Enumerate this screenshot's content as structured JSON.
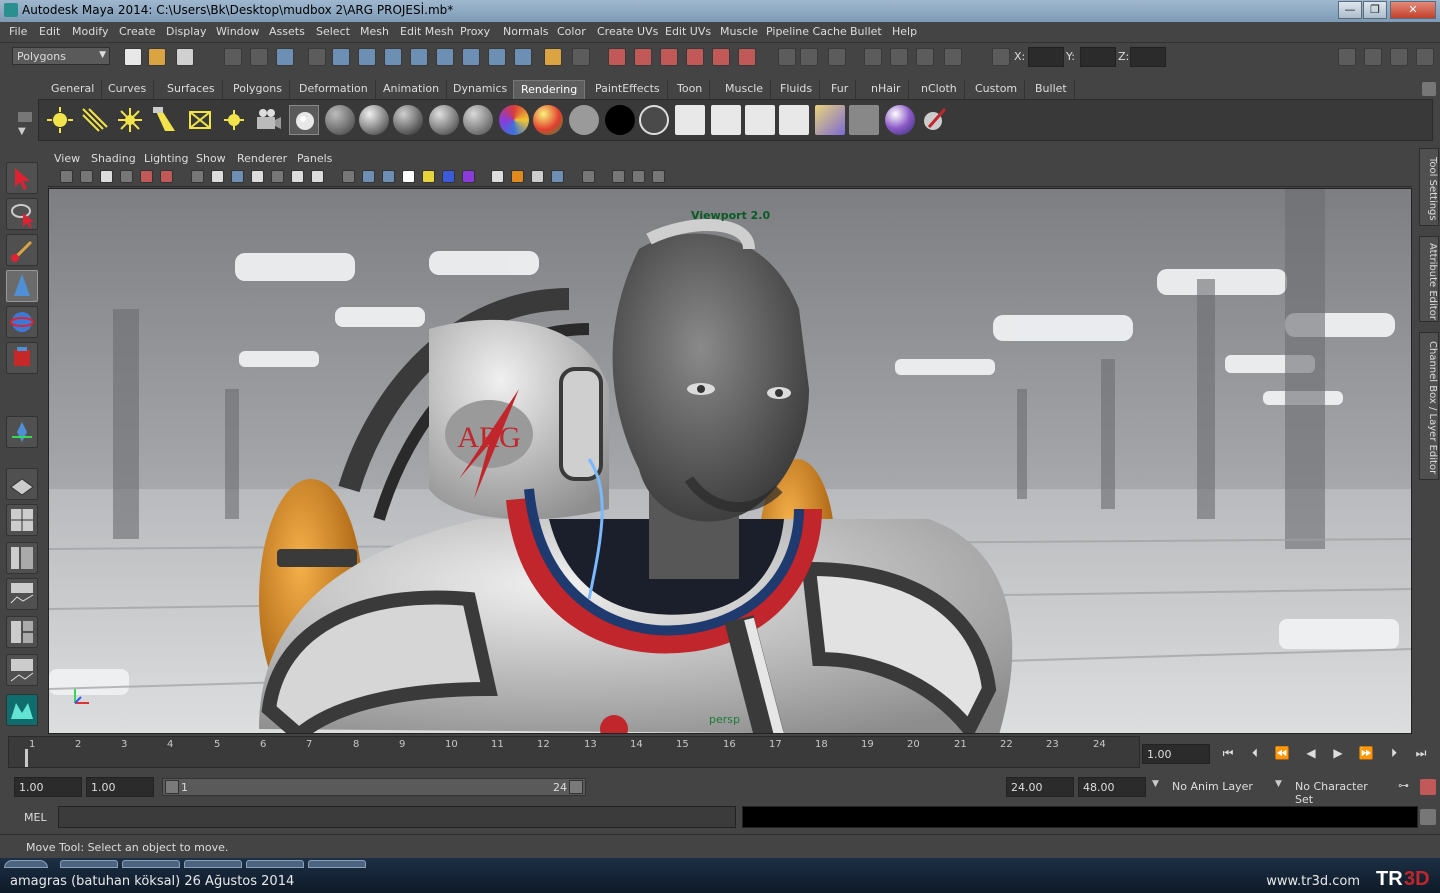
{
  "window": {
    "title": "Autodesk Maya 2014: C:\\Users\\Bk\\Desktop\\mudbox 2\\ARG PROJESİ.mb*",
    "controls": [
      "—",
      "❐",
      "✕"
    ]
  },
  "menubar": [
    "File",
    "Edit",
    "Modify",
    "Create",
    "Display",
    "Window",
    "Assets",
    "Select",
    "Mesh",
    "Edit Mesh",
    "Proxy",
    "Normals",
    "Color",
    "Create UVs",
    "Edit UVs",
    "Muscle",
    "Pipeline Cache",
    "Bullet",
    "Help"
  ],
  "statusline": {
    "mode": "Polygons",
    "x_label": "X:",
    "y_label": "Y:",
    "z_label": "Z:"
  },
  "shelf": {
    "tabs": [
      "General",
      "Curves",
      "Surfaces",
      "Polygons",
      "Deformation",
      "Animation",
      "Dynamics",
      "Rendering",
      "PaintEffects",
      "Toon",
      "Muscle",
      "Fluids",
      "Fur",
      "nHair",
      "nCloth",
      "Custom",
      "Bullet"
    ],
    "active_tab": "Rendering"
  },
  "panel": {
    "menus": [
      "View",
      "Shading",
      "Lighting",
      "Show",
      "Renderer",
      "Panels"
    ],
    "renderer_label": "Viewport 2.0",
    "camera_label": "persp",
    "scene_logo_text": "ARG"
  },
  "side_tabs": [
    "Tool Settings",
    "Attribute Editor",
    "Channel Box / Layer Editor"
  ],
  "timeline": {
    "ticks": [
      "1",
      "2",
      "3",
      "4",
      "5",
      "6",
      "7",
      "8",
      "9",
      "10",
      "11",
      "12",
      "13",
      "14",
      "15",
      "16",
      "17",
      "18",
      "19",
      "20",
      "21",
      "22",
      "23",
      "24"
    ],
    "current_frame": "1.00"
  },
  "range": {
    "start": "1.00",
    "playback_start": "1.00",
    "slider_left": "1",
    "slider_right": "24",
    "playback_end": "24.00",
    "end": "48.00",
    "anim_layer": "No Anim Layer",
    "character_set": "No Character Set"
  },
  "command": {
    "label": "MEL"
  },
  "helpline": "Move Tool: Select an object to move.",
  "footer": {
    "credit": "amagras (batuhan köksal)  26 Ağustos 2014",
    "site": "www.tr3d.com",
    "logo": "TR3D"
  },
  "colors": {
    "ui_bg": "#444444",
    "title_bar": "#8fa9c2",
    "viewport_label": "#0b5a26",
    "suit_orange": "#e08a1e",
    "suit_red": "#c0262b"
  }
}
